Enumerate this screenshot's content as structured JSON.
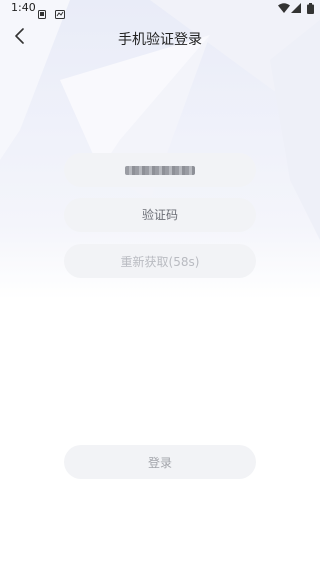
{
  "status_bar": {
    "time": "1:40"
  },
  "header": {
    "title": "手机验证登录"
  },
  "form": {
    "phone_masked": "",
    "code_placeholder": "验证码",
    "code_value": "",
    "resend_label": "重新获取(58s)"
  },
  "actions": {
    "login_label": "登录"
  },
  "icons": {
    "back": "chevron-left-icon",
    "status_a": "notification-icon",
    "status_b": "notification-icon",
    "wifi": "wifi-icon",
    "signal": "cell-signal-icon",
    "battery": "battery-icon"
  },
  "colors": {
    "field_background": "#f2f3f6",
    "disabled_text": "#b9bbc1",
    "decor_tint": "#e9ecf7"
  }
}
